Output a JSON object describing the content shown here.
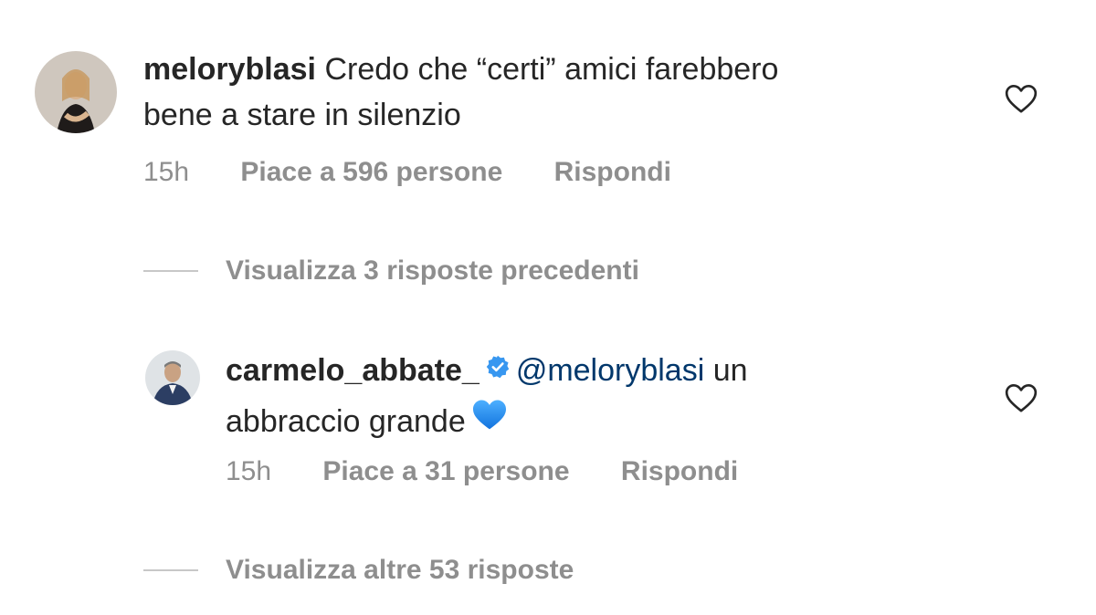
{
  "comments": [
    {
      "username": "meloryblasi",
      "text_line1": "Credo che “certi” amici farebbero",
      "text_line2": "bene a stare in silenzio",
      "time": "15h",
      "likes": "Piace a 596 persone",
      "reply": "Rispondi",
      "verified": false
    },
    {
      "username": "carmelo_abbate_",
      "mention": "@meloryblasi",
      "text_line1_rest": "un",
      "text_line2": "abbraccio grande",
      "emoji": "blue-heart",
      "time": "15h",
      "likes": "Piace a 31 persone",
      "reply": "Rispondi",
      "verified": true
    }
  ],
  "view_replies": [
    {
      "label": "Visualizza 3 risposte precedenti"
    },
    {
      "label": "Visualizza altre 53 risposte"
    }
  ],
  "icons": {
    "like": "heart-outline-icon",
    "verified": "verified-badge-icon",
    "emoji": "blue-heart-emoji"
  },
  "colors": {
    "text": "#262626",
    "secondary": "#8e8e8e",
    "mention": "#00376b",
    "verified": "#3897f0",
    "blue_heart": "#1d8cf8"
  }
}
